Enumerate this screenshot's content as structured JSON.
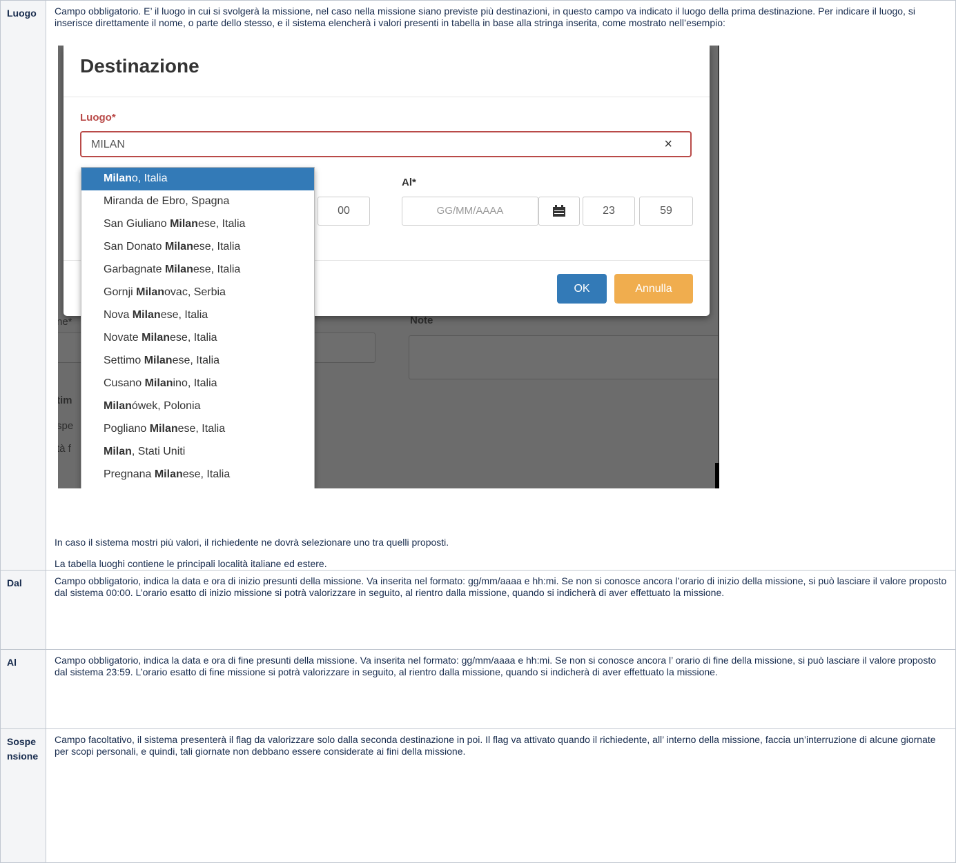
{
  "rows": {
    "luogo": {
      "label": "Luogo",
      "intro": "Campo obbligatorio. E’ il luogo in cui si svolgerà la missione, nel caso nella missione siano previste più destinazioni, in questo campo va indicato il luogo della prima destinazione. Per indicare il luogo, si inserisce direttamente il nome, o parte dello stesso, e il sistema elencherà i valori presenti in tabella in base alla stringa inserita, come mostrato nell’esempio:",
      "after1": "In caso il sistema mostri più valori, il richiedente ne dovrà selezionare uno tra quelli proposti.",
      "after2": "La tabella luoghi contiene le principali località italiane ed estere."
    },
    "dal": {
      "label": "Dal",
      "text": "Campo obbligatorio, indica la data e ora di inizio presunti della missione. Va inserita nel formato: gg/mm/aaaa e  hh:mi. Se non si conosce ancora l’orario di inizio della missione, si può lasciare il valore proposto dal sistema 00:00. L’orario esatto di inizio missione si potrà  valorizzare in seguito, al rientro dalla missione, quando si indicherà di aver effettuato la missione."
    },
    "al": {
      "label": "Al",
      "text": "Campo obbligatorio, indica la data e ora di fine presunti della missione. Va inserita nel formato: gg/mm/aaaa e  hh:mi. Se non si conosce ancora l’ orario di fine della missione, si può lasciare il valore proposto dal sistema 23:59. L’orario esatto di fine missione si potrà valorizzare in seguito, al rientro dalla missione, quando si indicherà di aver effettuato la missione."
    },
    "sospensione": {
      "label": "Sospensione",
      "text": "Campo facoltativo, il sistema presenterà il flag da valorizzare solo dalla seconda destinazione in poi. Il flag va attivato quando il richiedente, all’ interno della missione, faccia un’interruzione di alcune giornate per scopi personali, e quindi, tali giornate non debbano essere considerate ai fini della missione."
    }
  },
  "screenshot": {
    "modal_title": "Destinazione",
    "luogo_label": "Luogo*",
    "luogo_value": "MILAN",
    "clear_symbol": "×",
    "dal_minutes": "00",
    "al_label": "Al*",
    "al_date_placeholder": "GG/MM/AAAA",
    "al_hours": "23",
    "al_minutes": "59",
    "ok_label": "OK",
    "annulla_label": "Annulla",
    "note_label": "Note",
    "bg_fragments": [
      "ne*",
      "tim",
      "spe",
      "tà f"
    ],
    "colors": {
      "error": "#b94a48",
      "primary": "#337ab7",
      "warning": "#f0ad4e"
    },
    "dropdown_items": [
      {
        "pre": "",
        "match": "Milan",
        "post": "o, Italia"
      },
      {
        "pre": "Miranda de Ebro, Spagna",
        "match": "",
        "post": ""
      },
      {
        "pre": "San Giuliano ",
        "match": "Milan",
        "post": "ese, Italia"
      },
      {
        "pre": "San Donato ",
        "match": "Milan",
        "post": "ese, Italia"
      },
      {
        "pre": "Garbagnate ",
        "match": "Milan",
        "post": "ese, Italia"
      },
      {
        "pre": "Gornji ",
        "match": "Milan",
        "post": "ovac, Serbia"
      },
      {
        "pre": "Nova ",
        "match": "Milan",
        "post": "ese, Italia"
      },
      {
        "pre": "Novate ",
        "match": "Milan",
        "post": "ese, Italia"
      },
      {
        "pre": "Settimo ",
        "match": "Milan",
        "post": "ese, Italia"
      },
      {
        "pre": "Cusano ",
        "match": "Milan",
        "post": "ino, Italia"
      },
      {
        "pre": "",
        "match": "Milan",
        "post": "ówek, Polonia"
      },
      {
        "pre": "Pogliano ",
        "match": "Milan",
        "post": "ese, Italia"
      },
      {
        "pre": "",
        "match": "Milan",
        "post": ", Stati Uniti"
      },
      {
        "pre": "Pregnana ",
        "match": "Milan",
        "post": "ese, Italia"
      }
    ]
  }
}
